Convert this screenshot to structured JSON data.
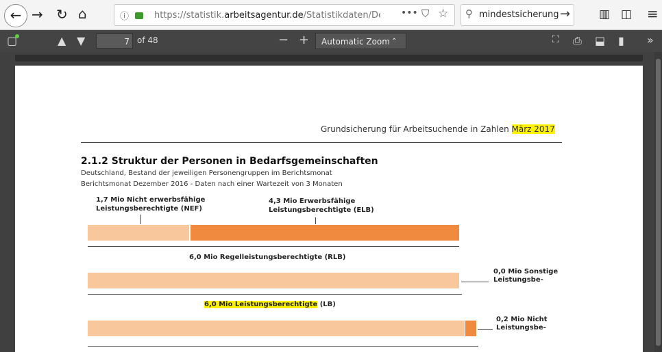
{
  "browser": {
    "url_prefix": "https://statistik.",
    "url_domain": "arbeitsagentur.de",
    "url_path": "/Statistikdaten/Detail/",
    "search_text": "mindestsicherung",
    "colors": {
      "secure": "#3a9a2a"
    }
  },
  "pdf_toolbar": {
    "page_number": "7",
    "page_of": "of 48",
    "zoom": "Automatic Zoom"
  },
  "document": {
    "header_text": "Grundsicherung für Arbeitsuchende in Zahlen ",
    "header_date": "März 2017",
    "section_title": "2.1.2 Struktur der Personen in Bedarfsgemeinschaften",
    "subtitle_1": "Deutschland, Bestand der jeweiligen Personengruppen im Berichtsmonat",
    "subtitle_2": "Berichtsmonat Dezember 2016 -  Daten nach einer Wartezeit von 3 Monaten",
    "label_nef_1": "1,7 Mio Nicht erwerbsfähige",
    "label_nef_2": "Leistungsberechtigte (NEF)",
    "label_elb_1": "4,3 Mio Erwerbsfähige",
    "label_elb_2": "Leistungsberechtigte (ELB)",
    "label_rlb": "6,0 Mio Regelleistungsberechtigte (RLB)",
    "label_sonst_1": "0,0 Mio Sonstige",
    "label_sonst_2": "Leistungsbe-",
    "label_lb_main": "6,0 Mio Leistungsberechtigte",
    "label_lb_suffix": " (LB)",
    "label_nicht_1": "0,2 Mio Nicht",
    "label_nicht_2": "Leistungsbe-",
    "colors": {
      "light_bar": "#f8c79b",
      "dark_bar": "#f08a3e",
      "highlight": "#fff200"
    }
  }
}
